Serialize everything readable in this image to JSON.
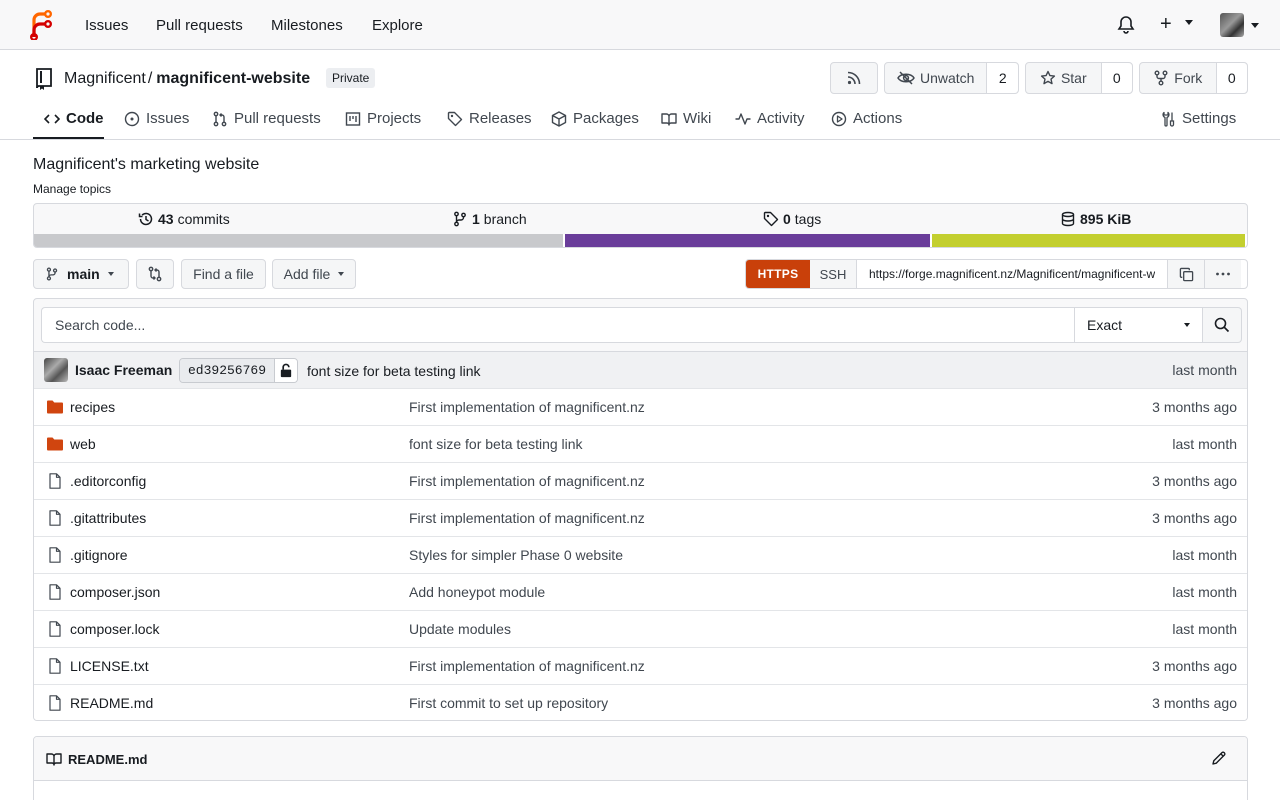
{
  "nav": {
    "links": [
      "Issues",
      "Pull requests",
      "Milestones",
      "Explore"
    ]
  },
  "repo": {
    "owner": "Magnificent",
    "name": "magnificent-website",
    "visibility": "Private",
    "description": "Magnificent's marketing website",
    "manage_topics": "Manage topics"
  },
  "actions": {
    "unwatch_label": "Unwatch",
    "watch_count": "2",
    "star_label": "Star",
    "star_count": "0",
    "fork_label": "Fork",
    "fork_count": "0"
  },
  "tabs": {
    "code": "Code",
    "issues": "Issues",
    "pulls": "Pull requests",
    "projects": "Projects",
    "releases": "Releases",
    "packages": "Packages",
    "wiki": "Wiki",
    "activity": "Activity",
    "actions": "Actions",
    "settings": "Settings"
  },
  "stats": {
    "commits_count": "43",
    "commits_label": "commits",
    "branch_count": "1",
    "branch_label": "branch",
    "tags_count": "0",
    "tags_label": "tags",
    "size": "895 KiB"
  },
  "language_bar": [
    {
      "color": "#c8c9cc",
      "fraction": 0.438
    },
    {
      "color": "#6a3d9a",
      "fraction": 0.302
    },
    {
      "color": "#c3cf2f",
      "fraction": 0.26
    }
  ],
  "toolbar": {
    "branch": "main",
    "find_file": "Find a file",
    "add_file": "Add file",
    "https": "HTTPS",
    "ssh": "SSH",
    "clone_url": "https://forge.magnificent.nz/Magnificent/magnificent-website.git"
  },
  "search": {
    "placeholder": "Search code...",
    "mode": "Exact"
  },
  "last_commit": {
    "author": "Isaac Freeman",
    "sha": "ed39256769",
    "message": "font size for beta testing link",
    "time": "last month"
  },
  "files": [
    {
      "name": "recipes",
      "type": "dir",
      "message": "First implementation of magnificent.nz",
      "time": "3 months ago"
    },
    {
      "name": "web",
      "type": "dir",
      "message": "font size for beta testing link",
      "time": "last month"
    },
    {
      "name": ".editorconfig",
      "type": "file",
      "message": "First implementation of magnificent.nz",
      "time": "3 months ago"
    },
    {
      "name": ".gitattributes",
      "type": "file",
      "message": "First implementation of magnificent.nz",
      "time": "3 months ago"
    },
    {
      "name": ".gitignore",
      "type": "file",
      "message": "Styles for simpler Phase 0 website",
      "time": "last month"
    },
    {
      "name": "composer.json",
      "type": "file",
      "message": "Add honeypot module",
      "time": "last month"
    },
    {
      "name": "composer.lock",
      "type": "file",
      "message": "Update modules",
      "time": "last month"
    },
    {
      "name": "LICENSE.txt",
      "type": "file",
      "message": "First implementation of magnificent.nz",
      "time": "3 months ago"
    },
    {
      "name": "README.md",
      "type": "file",
      "message": "First commit to set up repository",
      "time": "3 months ago"
    }
  ],
  "readme": {
    "title": "README.md"
  },
  "colors": {
    "accent": "#c9400a",
    "folder": "#d0450f"
  }
}
